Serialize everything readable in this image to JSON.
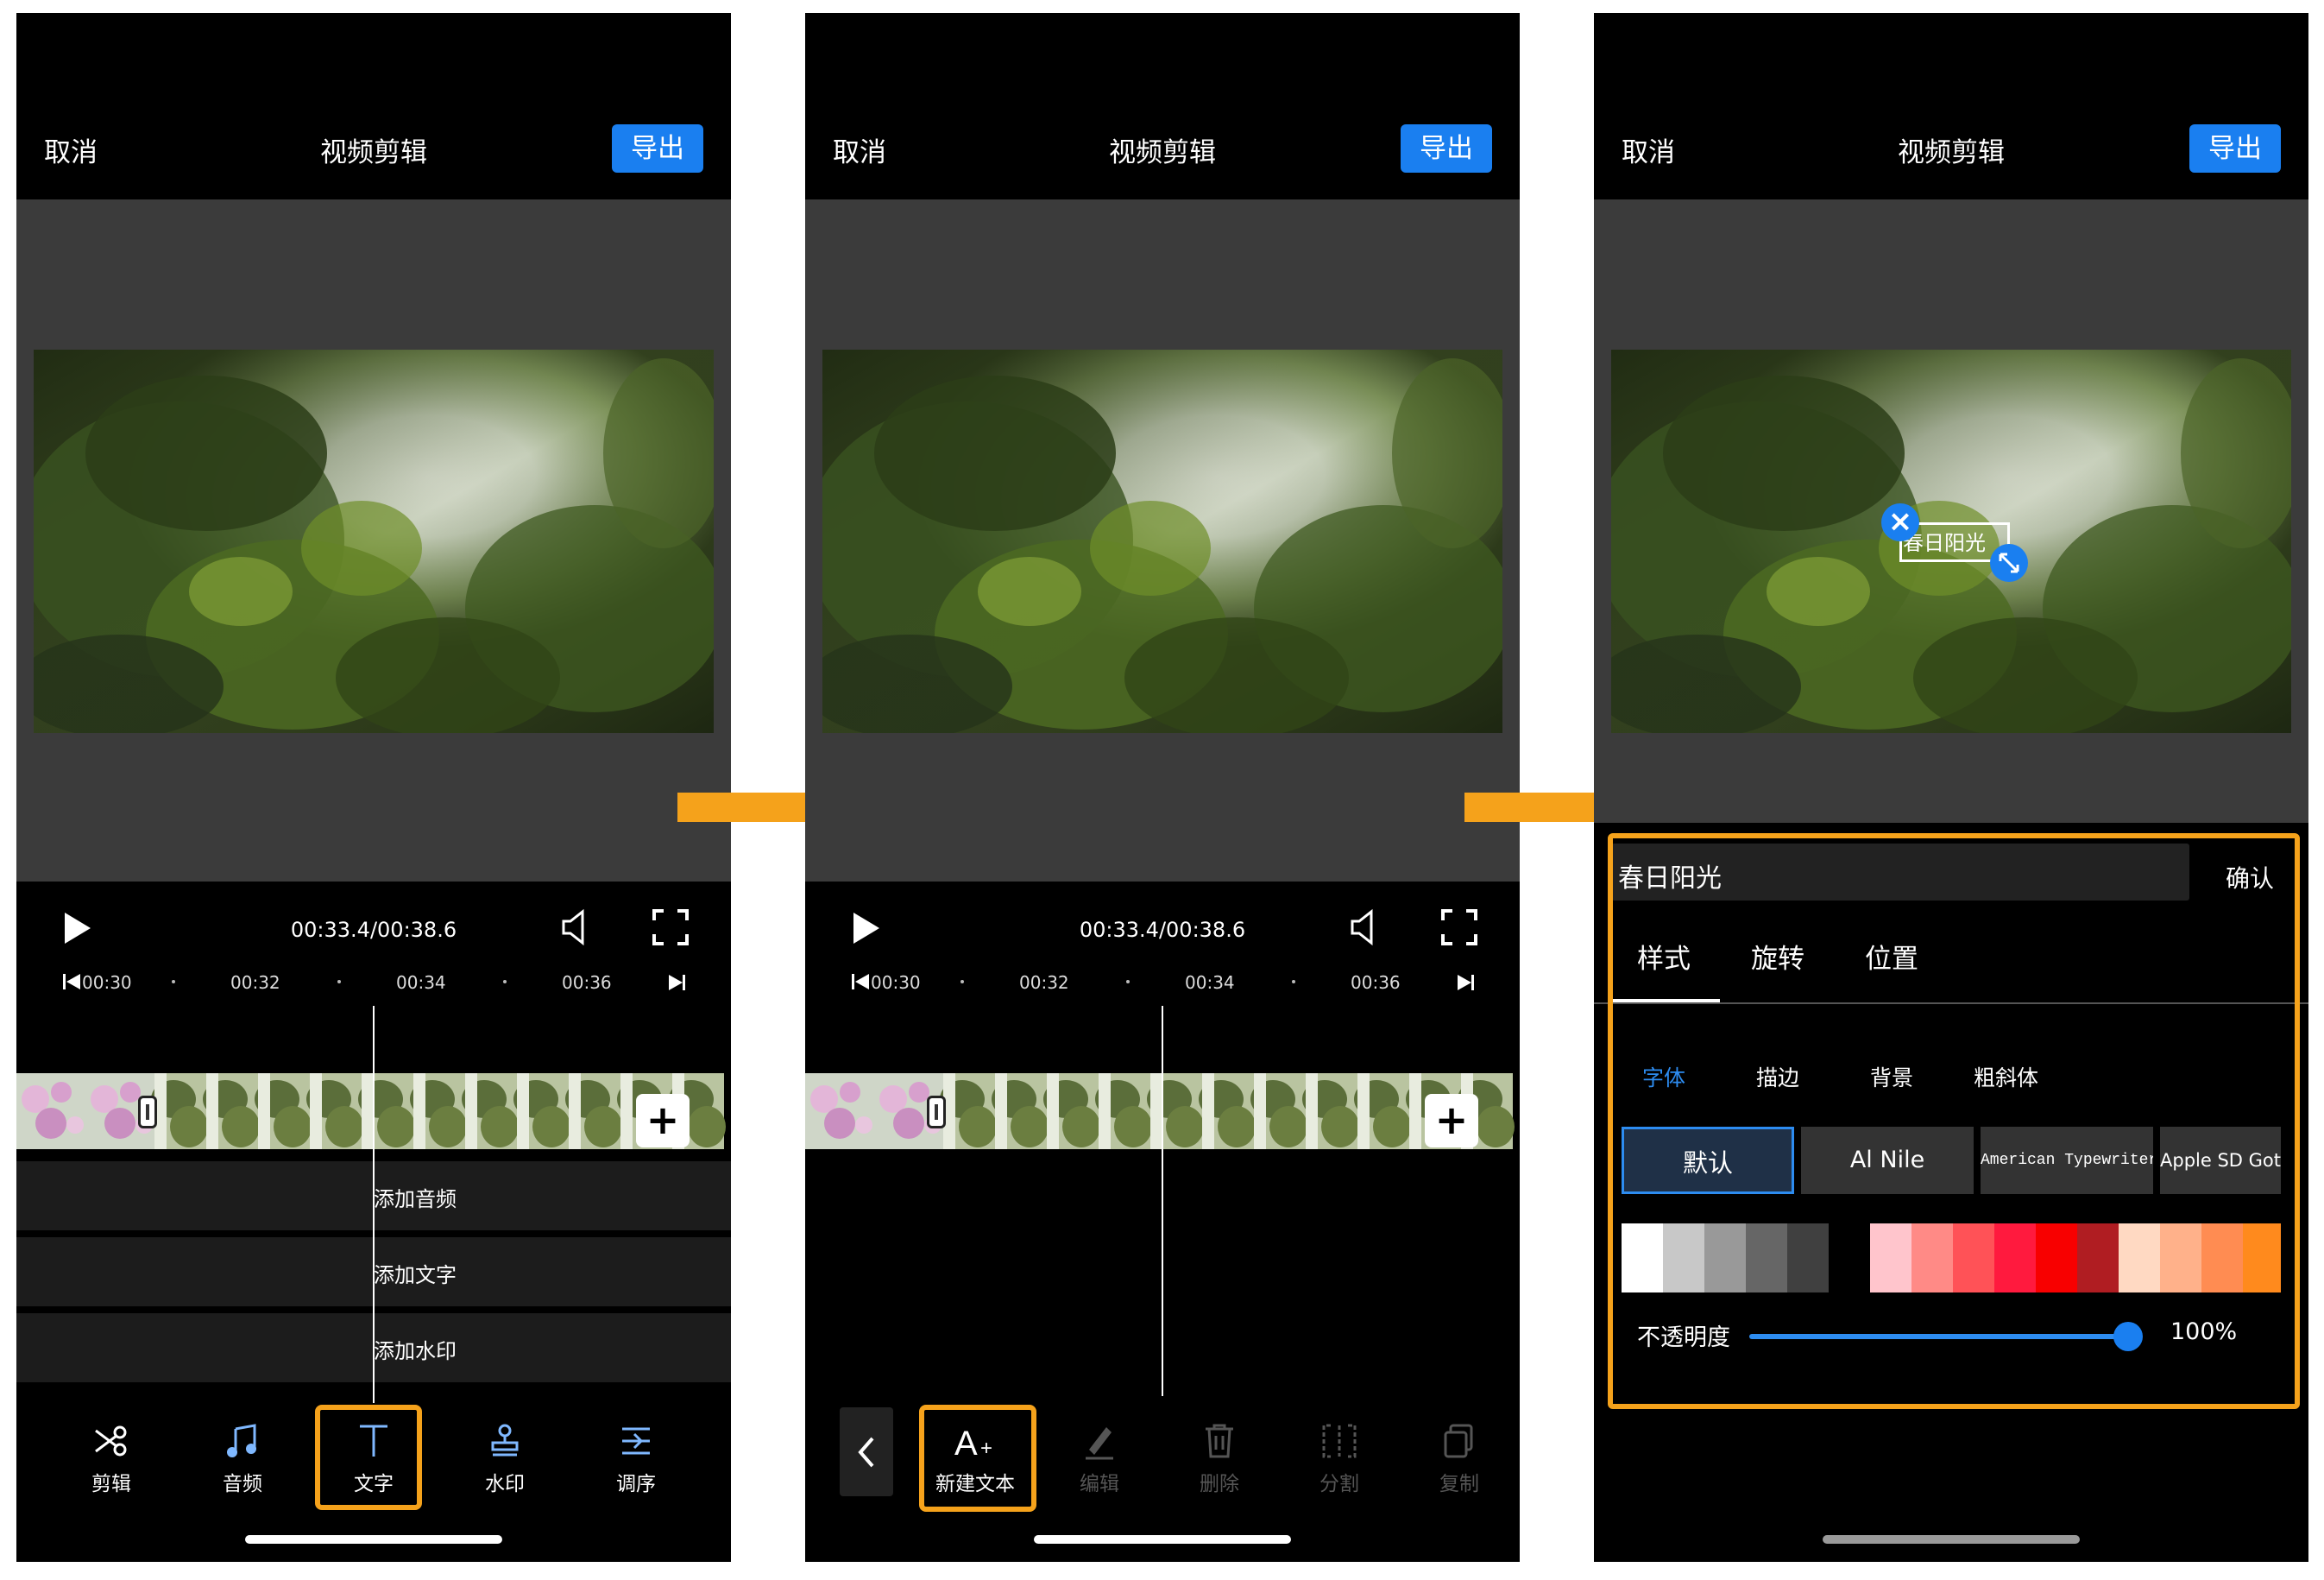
{
  "header": {
    "cancel": "取消",
    "title": "视频剪辑",
    "export": "导出"
  },
  "player": {
    "timecode": "00:33.4/00:38.6"
  },
  "ruler": {
    "ticks": [
      "00:30",
      "00:32",
      "00:34",
      "00:36"
    ]
  },
  "tracks": {
    "audio": "添加音频",
    "text": "添加文字",
    "watermark": "添加水印"
  },
  "main_tools": [
    {
      "label": "剪辑",
      "icon": "scissors-icon"
    },
    {
      "label": "音频",
      "icon": "music-note-icon"
    },
    {
      "label": "文字",
      "icon": "text-t-icon"
    },
    {
      "label": "水印",
      "icon": "stamp-icon"
    },
    {
      "label": "调序",
      "icon": "reorder-icon"
    }
  ],
  "text_tools": [
    {
      "label": "新建文本",
      "icon": "new-text-icon"
    },
    {
      "label": "编辑",
      "icon": "pencil-icon"
    },
    {
      "label": "删除",
      "icon": "trash-icon"
    },
    {
      "label": "分割",
      "icon": "split-icon"
    },
    {
      "label": "复制",
      "icon": "copy-icon"
    }
  ],
  "text_panel": {
    "overlay_text": "春日阳光",
    "input_value": "春日阳光",
    "confirm": "确认",
    "tabs": [
      "样式",
      "旋转",
      "位置"
    ],
    "subtabs": [
      "字体",
      "描边",
      "背景",
      "粗斜体"
    ],
    "fonts": [
      "默认",
      "Al Nile",
      "American Typewriter",
      "Apple SD Goth"
    ],
    "opacity_label": "不透明度",
    "opacity_value": "100%",
    "opacity_fraction": 1.0
  },
  "colors": {
    "accent": "#1a7ff0",
    "highlight": "#f5a21b",
    "gray_swatches": [
      "#ffffff",
      "#c8c8c8",
      "#999999",
      "#666666",
      "#404040"
    ],
    "warm_swatches": [
      "#ffc5cc",
      "#ff8a86",
      "#ff5257",
      "#ff1a3e",
      "#f80000",
      "#b01d22",
      "#ffd9c2",
      "#ffb18a",
      "#ff8c52",
      "#ff8a1d"
    ]
  }
}
